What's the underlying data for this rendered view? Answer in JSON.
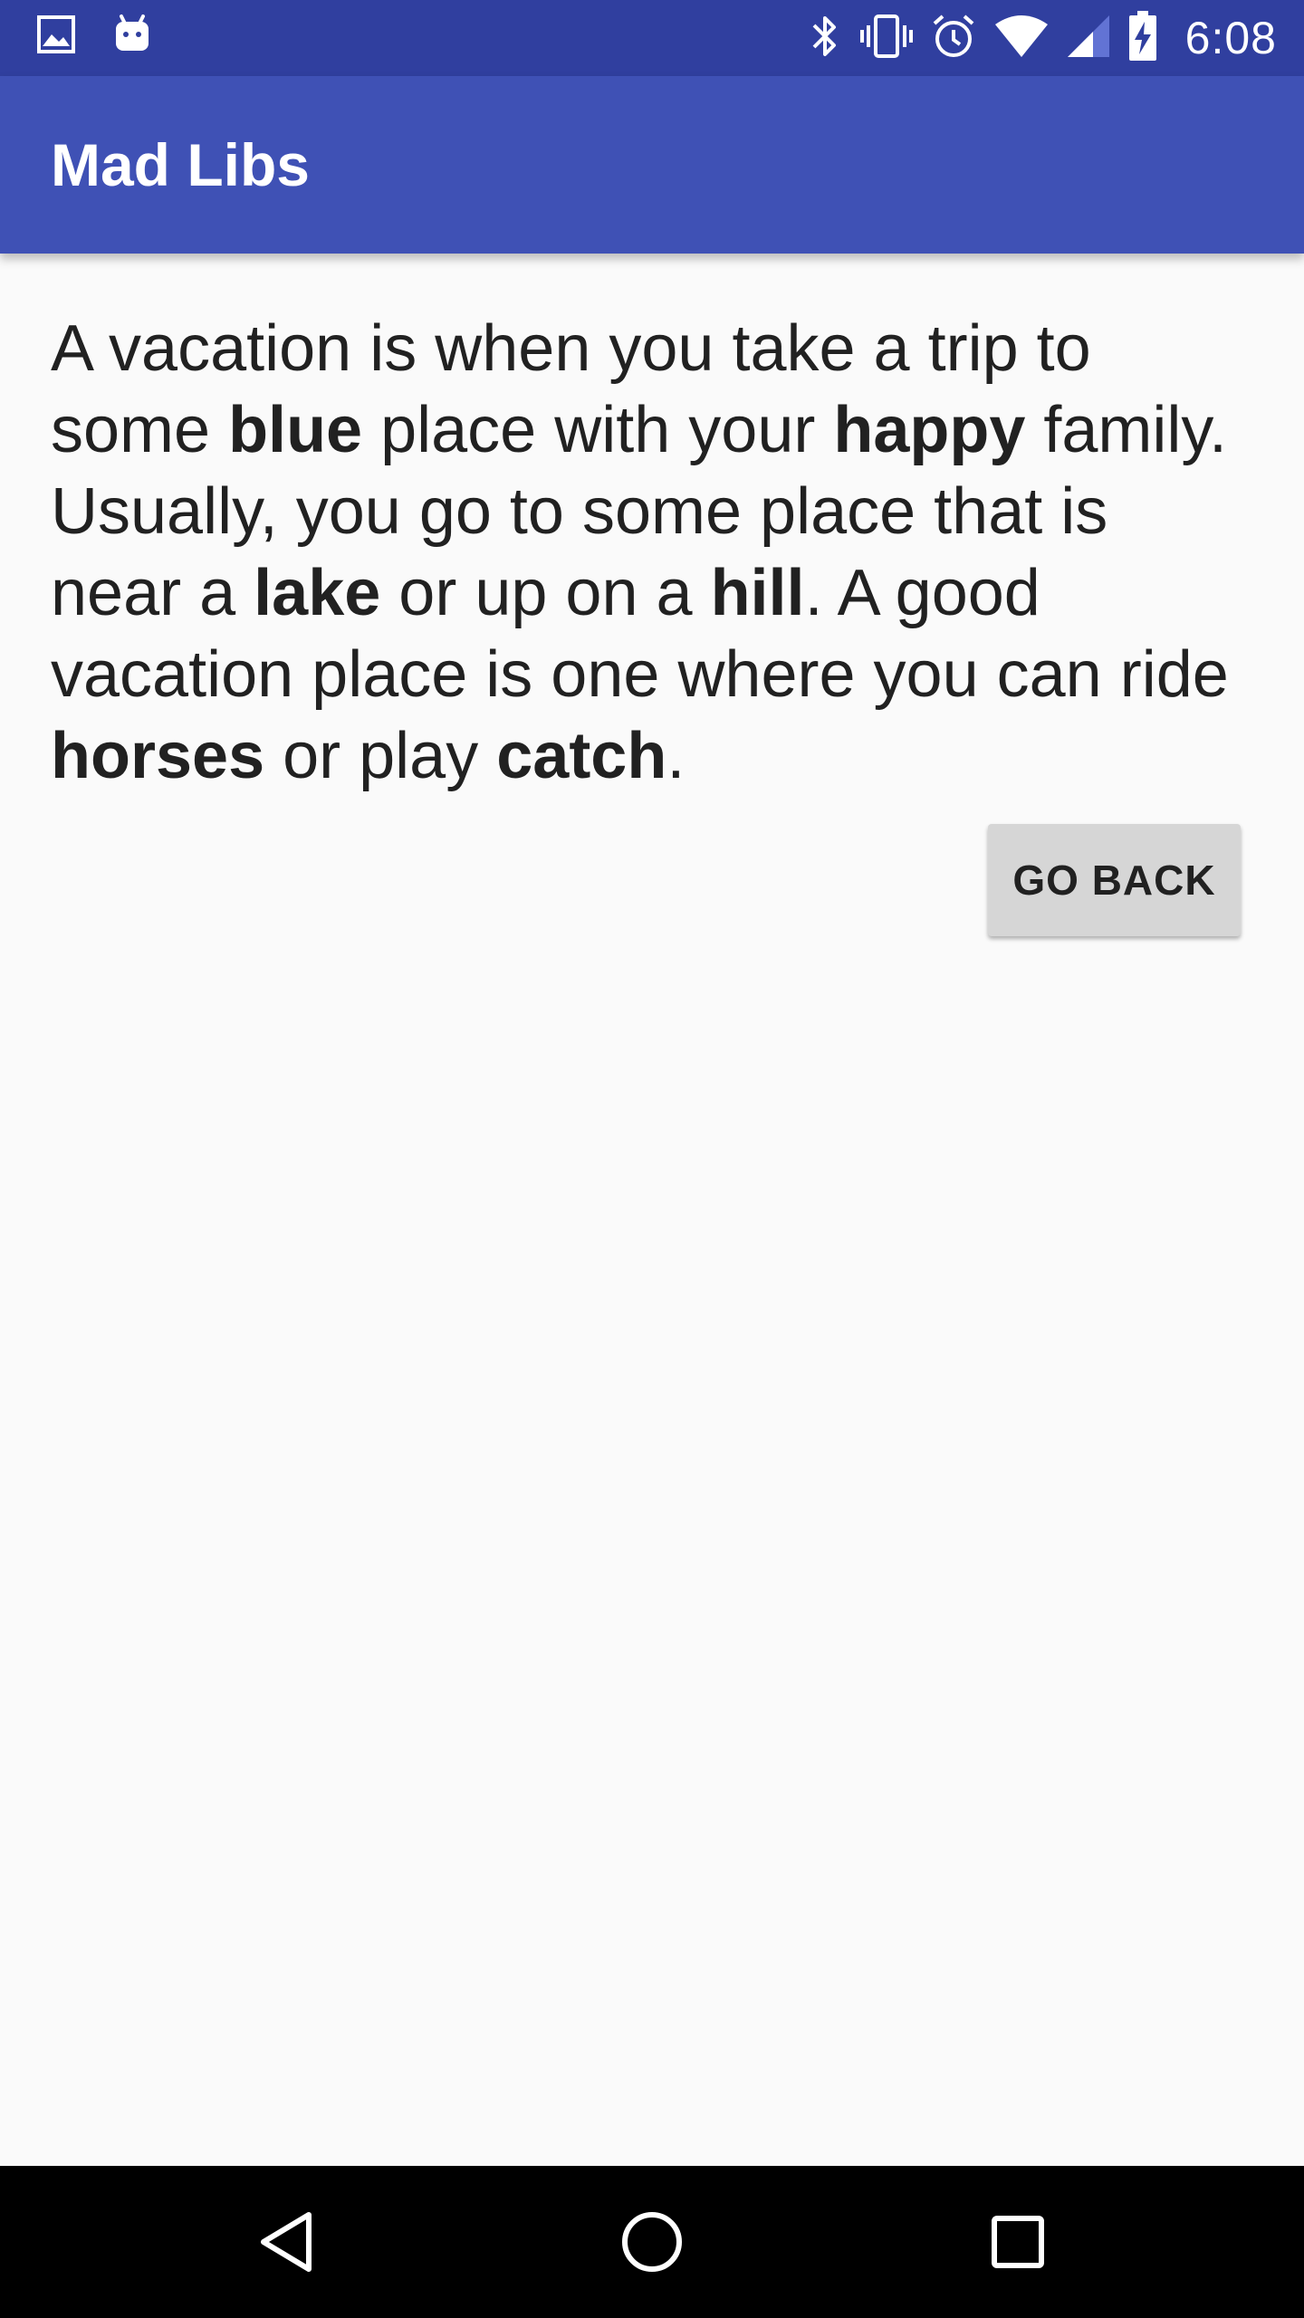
{
  "status_bar": {
    "time": "6:08",
    "icons_left": [
      "image-icon",
      "android-icon"
    ],
    "icons_right": [
      "bluetooth-icon",
      "vibrate-icon",
      "alarm-icon",
      "wifi-icon",
      "signal-icon",
      "battery-charging-icon"
    ]
  },
  "app_bar": {
    "title": "Mad Libs"
  },
  "story": {
    "segments": [
      {
        "text": "A vacation is when you take a trip to some ",
        "bold": false
      },
      {
        "text": "blue",
        "bold": true
      },
      {
        "text": " place with your ",
        "bold": false
      },
      {
        "text": "happy",
        "bold": true
      },
      {
        "text": " family. Usually, you go to some place that is near a ",
        "bold": false
      },
      {
        "text": "lake",
        "bold": true
      },
      {
        "text": " or up on a ",
        "bold": false
      },
      {
        "text": "hill",
        "bold": true
      },
      {
        "text": ". A good vacation place is one where you can ride ",
        "bold": false
      },
      {
        "text": "horses",
        "bold": true
      },
      {
        "text": " or play ",
        "bold": false
      },
      {
        "text": "catch",
        "bold": true
      },
      {
        "text": ".",
        "bold": false
      }
    ]
  },
  "actions": {
    "go_back_label": "GO BACK"
  },
  "nav_bar": {
    "buttons": [
      "back-icon",
      "home-icon",
      "recents-icon"
    ]
  },
  "colors": {
    "status_bar": "#303f9f",
    "app_bar": "#3f51b5",
    "background": "#fafafa",
    "button": "#d6d6d6",
    "text": "#212121"
  }
}
